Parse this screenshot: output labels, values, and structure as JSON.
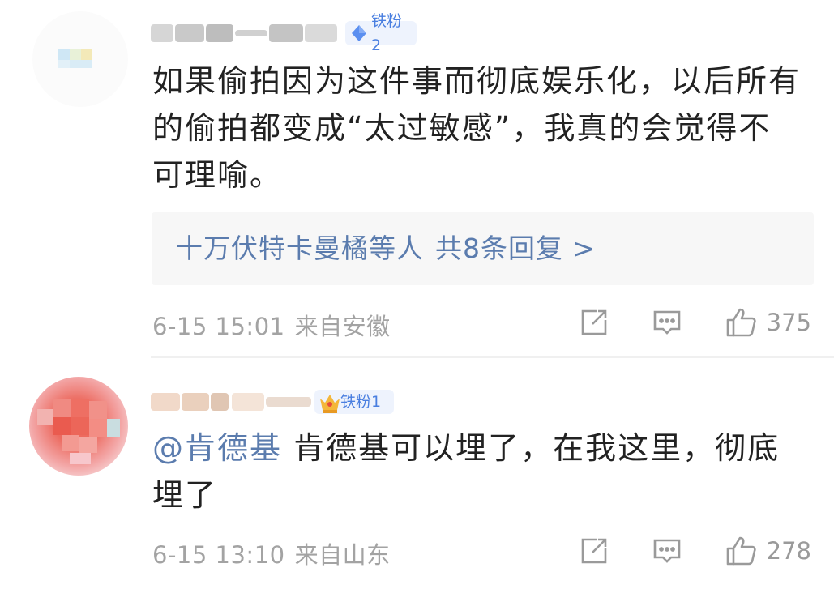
{
  "colors": {
    "link": "#5b7cae",
    "badge_bg": "#eef3fd",
    "badge_text": "#4a7fe0",
    "meta": "#a3a3a3",
    "reply_bg": "#f7f7f7"
  },
  "comments": [
    {
      "username": "",
      "badge": {
        "icon": "diamond-icon",
        "label": "铁粉2"
      },
      "text_lines": [
        "如果偷拍因为这件事而彻底娱乐化，以后所有",
        "的偷拍都变成“太过敏感”，我真的会觉得不",
        "可理喻。"
      ],
      "replies": {
        "names": "十万伏特卡曼橘等人",
        "count_label": "共8条回复 >"
      },
      "date": "6-15 15:01",
      "location": "来自安徽",
      "likes": "375"
    },
    {
      "username": "",
      "badge": {
        "icon": "crown-icon",
        "label": "铁粉1"
      },
      "mention": "@肯德基",
      "text_line1": "肯德基可以埋了，在我这里，彻底",
      "text_line2": "埋了",
      "date": "6-15 13:10",
      "location": "来自山东",
      "likes": "278"
    }
  ]
}
